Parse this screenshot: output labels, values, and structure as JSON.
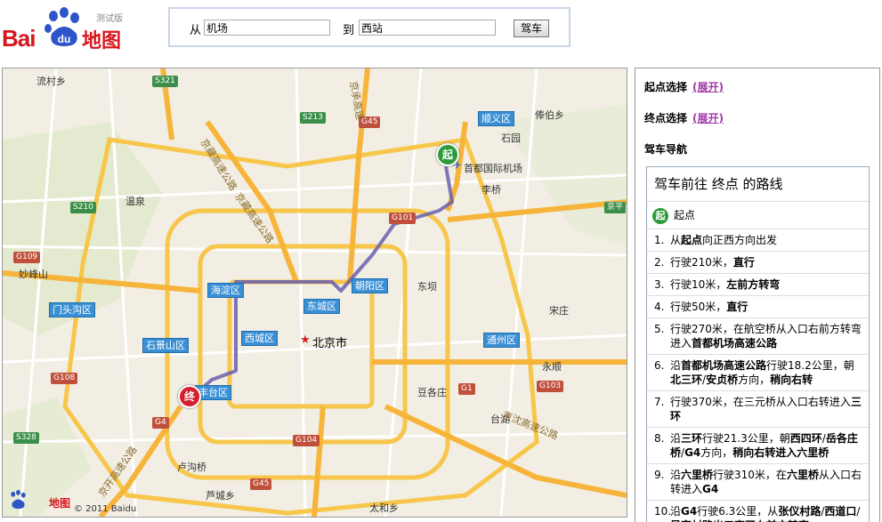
{
  "header": {
    "logo_text": "Bai",
    "logo_du": "du",
    "logo_map": "地图",
    "logo_beta": "测试版",
    "from_label": "从",
    "from_value": "机场",
    "to_label": "到",
    "to_value": "西站",
    "drive_button": "驾车"
  },
  "map": {
    "place_labels": [
      "流村乡",
      "温泉",
      "妙峰山",
      "首都国际机场",
      "李桥",
      "石园",
      "俸伯乡",
      "东坝",
      "宋庄",
      "永顺",
      "豆各庄",
      "台湖",
      "卢沟桥",
      "芦城乡",
      "太和乡",
      "北京市"
    ],
    "shields": [
      "S321",
      "S213",
      "G45",
      "G101",
      "S210",
      "G109",
      "G108",
      "G4",
      "S328",
      "G104",
      "G45",
      "G1",
      "G103",
      "京平"
    ],
    "districts": [
      "顺义区",
      "海淀区",
      "朝阳区",
      "东城区",
      "门头沟区",
      "西城区",
      "石景山区",
      "通州区",
      "丰台区"
    ],
    "roads": [
      "京藏高速公路",
      "京承高速公路",
      "京开高速公路",
      "京沈高速公路",
      "京承高速"
    ],
    "start_pin": "起",
    "end_pin": "终",
    "copyright": "© 2011 Baidu",
    "colors": {
      "route": "#6a5fb0",
      "road_major": "#f7c64a",
      "district": "#3a8fd4"
    }
  },
  "panel": {
    "start_select": "起点选择",
    "start_expand": "(展开)",
    "end_select": "终点选择",
    "end_expand": "(展开)",
    "nav_title": "驾车导航",
    "route_title": "驾车前往 终点 的路线",
    "start_icon": "起",
    "start_label": "起点",
    "steps": [
      {
        "num": "1.",
        "html_parts": [
          "从",
          "起点",
          "向正西方向出发"
        ]
      },
      {
        "num": "2.",
        "html_parts": [
          "行驶210米，",
          "直行",
          ""
        ]
      },
      {
        "num": "3.",
        "html_parts": [
          "行驶10米，",
          "左前方转弯",
          ""
        ]
      },
      {
        "num": "4.",
        "html_parts": [
          "行驶50米，",
          "直行",
          ""
        ]
      },
      {
        "num": "5.",
        "html_parts": [
          "行驶270米，在",
          "航空桥",
          "从入口右前方转弯进入",
          "首都机场高速公路"
        ]
      },
      {
        "num": "6.",
        "html_parts": [
          "沿",
          "首都机场高速公路",
          "行驶18.2公里，朝",
          "北三环",
          "/",
          "安贞桥",
          "方向，",
          "稍向右转"
        ]
      },
      {
        "num": "7.",
        "html_parts": [
          "行驶370米，在",
          "三元桥",
          "从入口右转进入",
          "三环"
        ]
      },
      {
        "num": "8.",
        "html_parts": [
          "沿",
          "三环",
          "行驶21.3公里，朝",
          "西四环",
          "/",
          "岳各庄桥",
          "/",
          "G4",
          "方向，",
          "稍向右转进入",
          "六里桥"
        ]
      },
      {
        "num": "9.",
        "html_parts": [
          "沿",
          "六里桥",
          "行驶310米，在",
          "六里桥",
          "从入口右转进入",
          "G4"
        ]
      },
      {
        "num": "10.",
        "html_parts": [
          "沿",
          "G4",
          "行驶6.3公里，从",
          "张仪村路",
          "/",
          "西道口",
          "/",
          "吴家村路出口离开右前方转弯"
        ]
      }
    ]
  }
}
